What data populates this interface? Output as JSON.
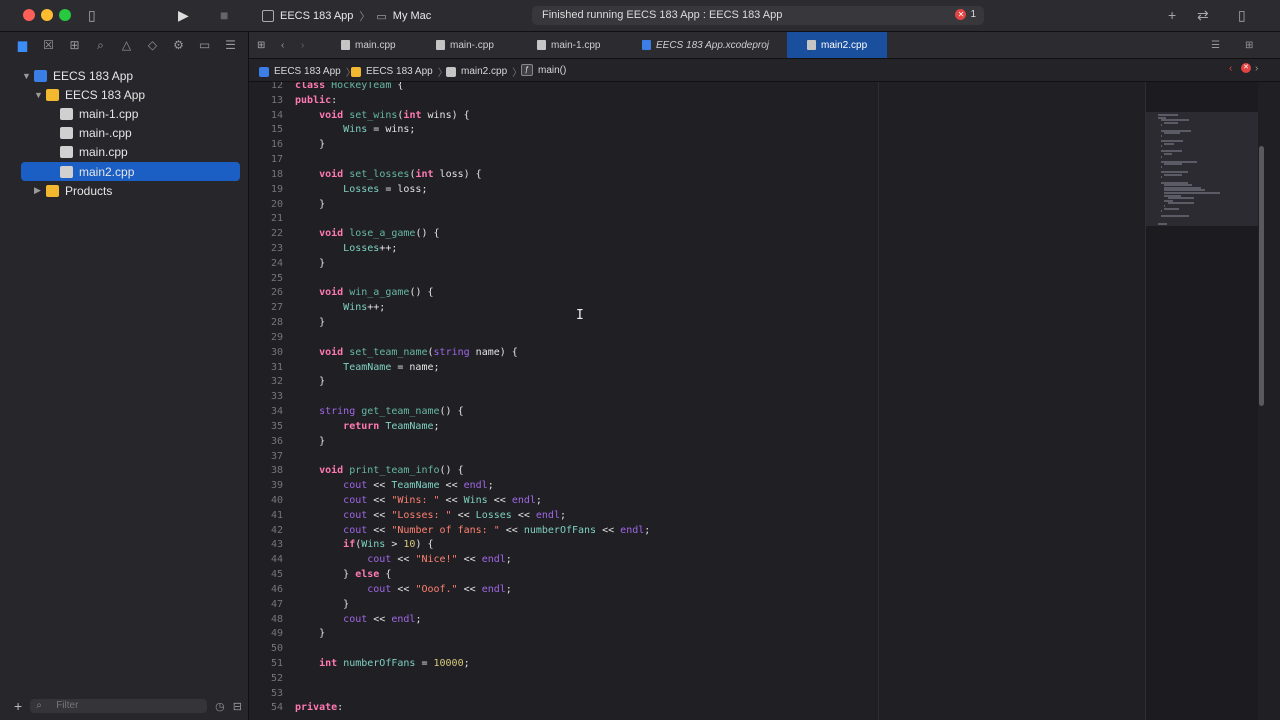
{
  "window": {
    "scheme_name": "EECS 183 App",
    "destination": "My Mac",
    "status_text": "Finished running EECS 183 App : EECS 183 App",
    "error_count": "1"
  },
  "sidebar": {
    "project": "EECS 183 App",
    "group": "EECS 183 App",
    "files": [
      "main-1.cpp",
      "main-.cpp",
      "main.cpp",
      "main2.cpp"
    ],
    "selected_file": "main2.cpp",
    "products": "Products",
    "filter_placeholder": "Filter"
  },
  "tabs": [
    {
      "label": "main.cpp"
    },
    {
      "label": "main-.cpp"
    },
    {
      "label": "main-1.cpp"
    },
    {
      "label": "EECS 183 App.xcodeproj"
    },
    {
      "label": "main2.cpp"
    }
  ],
  "jumpbar": {
    "project": "EECS 183 App",
    "group": "EECS 183 App",
    "file": "main2.cpp",
    "symbol": "main()"
  },
  "code": {
    "line_numbers": [
      "12",
      "13",
      "14",
      "15",
      "16",
      "17",
      "18",
      "19",
      "20",
      "21",
      "22",
      "23",
      "24",
      "25",
      "26",
      "27",
      "28",
      "29",
      "30",
      "31",
      "32",
      "33",
      "34",
      "35",
      "36",
      "37",
      "38",
      "39",
      "40",
      "41",
      "42",
      "43",
      "44",
      "45",
      "46",
      "47",
      "48",
      "49",
      "50",
      "51",
      "52",
      "53",
      "54"
    ],
    "lines": [
      "class HockeyTeam {",
      "public:",
      "    void set_wins(int wins) {",
      "        Wins = wins;",
      "    }",
      "",
      "    void set_losses(int loss) {",
      "        Losses = loss;",
      "    }",
      "",
      "    void lose_a_game() {",
      "        Losses++;",
      "    }",
      "",
      "    void win_a_game() {",
      "        Wins++;",
      "    }",
      "",
      "    void set_team_name(string name) {",
      "        TeamName = name;",
      "    }",
      "",
      "    string get_team_name() {",
      "        return TeamName;",
      "    }",
      "",
      "    void print_team_info() {",
      "        cout << TeamName << endl;",
      "        cout << \"Wins: \" << Wins << endl;",
      "        cout << \"Losses: \" << Losses << endl;",
      "        cout << \"Number of fans: \" << numberOfFans << endl;",
      "        if(Wins > 10) {",
      "            cout << \"Nice!\" << endl;",
      "        } else {",
      "            cout << \"Ooof.\" << endl;",
      "        }",
      "        cout << endl;",
      "    }",
      "",
      "    int numberOfFans = 10000;",
      "",
      "",
      "private:"
    ]
  },
  "colors": {
    "accent": "#1b5fc4",
    "keyword": "#ff7ab2",
    "string": "#ff8170",
    "number": "#d9c97c",
    "function": "#67b7a4"
  }
}
